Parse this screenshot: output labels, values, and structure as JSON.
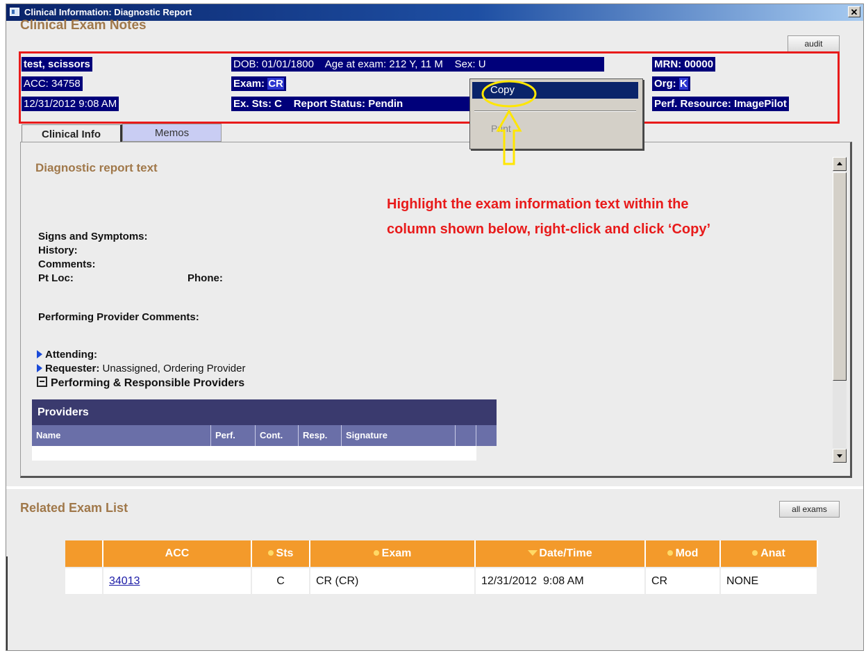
{
  "window": {
    "title": "Clinical Information: Diagnostic Report",
    "close_glyph": "✕"
  },
  "clinical_exam_notes": {
    "title": "Clinical Exam Notes",
    "audit_label": "audit",
    "patient_name": "test, scissors",
    "acc": "ACC: 34758",
    "exam_datetime": "12/31/2012 9:08 AM",
    "dob": "DOB: 01/01/1800",
    "age_at_exam": "Age at exam: 212 Y, 11 M",
    "sex": "Sex: U",
    "exam_label": "Exam:",
    "exam_value": "CR",
    "ex_sts": "Ex. Sts: C",
    "report_status": "Report Status: Pendin",
    "mrn": "MRN: 00000",
    "org_label": "Org:",
    "org_value": "K",
    "perf_resource": "Perf. Resource: ImagePilot"
  },
  "context_menu": {
    "copy": "Copy",
    "print": "Print"
  },
  "tabs": [
    {
      "label": "Clinical Info",
      "active": true
    },
    {
      "label": "Memos",
      "active": false
    }
  ],
  "report": {
    "heading": "Diagnostic report text",
    "signs_symptoms": "Signs and Symptoms:",
    "history": "History:",
    "comments": "Comments:",
    "pt_loc": "Pt Loc:",
    "phone": "Phone:",
    "performing_comments": "Performing Provider Comments:",
    "attending": "Attending:",
    "requester_label": "Requester:",
    "requester_value": " Unassigned, Ordering Provider",
    "performing_responsible": "Performing & Responsible Providers"
  },
  "annotation": {
    "line1": "Highlight the exam information text within the",
    "line2": "column shown below, right-click and click ‘Copy’"
  },
  "providers_table": {
    "title": "Providers",
    "columns": [
      "Name",
      "Perf.",
      "Cont.",
      "Resp.",
      "Signature"
    ]
  },
  "related_exams": {
    "title": "Related Exam List",
    "all_exams_label": "all exams",
    "columns": [
      "",
      "ACC",
      "Sts",
      "Exam",
      "Date/Time",
      "Mod",
      "Anat"
    ],
    "rows": [
      {
        "acc": "34013",
        "sts": "C",
        "exam": "CR (CR)",
        "datetime": "12/31/2012  9:08 AM",
        "mod": "CR",
        "anat": "NONE"
      }
    ]
  },
  "colors": {
    "accent_orange": "#f39a2b",
    "highlight_navy": "#00007a",
    "title_brown": "#a0784a",
    "annotation_red": "#e81a1a",
    "annotation_yellow": "#ffe600"
  }
}
